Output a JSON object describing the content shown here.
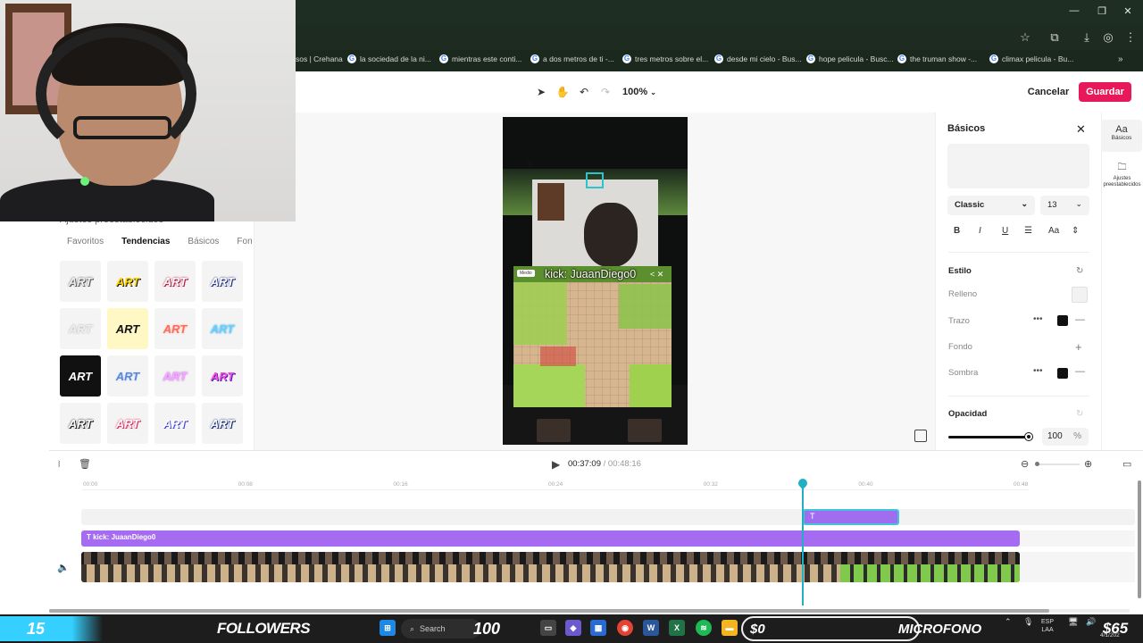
{
  "browser": {
    "bookmarks": [
      {
        "label": "sos | Crehana"
      },
      {
        "label": "la sociedad de la ni..."
      },
      {
        "label": "mientras este conti..."
      },
      {
        "label": "a dos metros de ti -..."
      },
      {
        "label": "tres metros sobre el..."
      },
      {
        "label": "desde mi cielo - Bus..."
      },
      {
        "label": "hope pelicula - Busc..."
      },
      {
        "label": "the truman show -..."
      },
      {
        "label": "climax pelicula - Bu..."
      }
    ]
  },
  "toolbar": {
    "zoom": "100%",
    "cancel_label": "Cancelar",
    "save_label": "Guardar"
  },
  "presets": {
    "title": "Ajustes preestablecidos",
    "tabs": [
      "Favoritos",
      "Tendencias",
      "Básicos",
      "Fon"
    ],
    "active_tab": "Tendencias",
    "tile_text": "ART"
  },
  "canvas": {
    "caption": "kick: JuaanDiego0",
    "mode_label": "Medio"
  },
  "properties": {
    "title": "Básicos",
    "font": "Classic",
    "size": "13",
    "style_section": "Estilo",
    "fill_label": "Relleno",
    "stroke_label": "Trazo",
    "background_label": "Fondo",
    "shadow_label": "Sombra",
    "opacity_section": "Opacidad",
    "opacity_value": "100",
    "opacity_unit": "%",
    "case_label": "Aa"
  },
  "right_sidebar": {
    "basic_glyph": "Aa",
    "basic_label": "Básicos",
    "presets_label": "Ajustes preestablecidos"
  },
  "timeline": {
    "current_time": "00:37:09",
    "separator": "/",
    "total_time": "00:48:16",
    "ticks": [
      "00:00",
      "00:08",
      "00:16",
      "00:24",
      "00:32",
      "00:40",
      "00:48"
    ],
    "text_clip": "T",
    "text_track": "kick: JuaanDiego0",
    "playhead_fraction": 0.77
  },
  "taskbar": {
    "sticker_count": "15",
    "followers_label": "FOLLOWERS",
    "search_label": "Search",
    "followers_goal": "100",
    "money_left": "$0",
    "mic_label": "MICROFONO",
    "money_right": "$65",
    "lang": "ESP",
    "lang_sub": "LAA",
    "date": "4/1/202"
  },
  "colors": {
    "accent": "#e8195a",
    "text_clip": "#a56cf2",
    "playhead": "#20b0c2"
  }
}
